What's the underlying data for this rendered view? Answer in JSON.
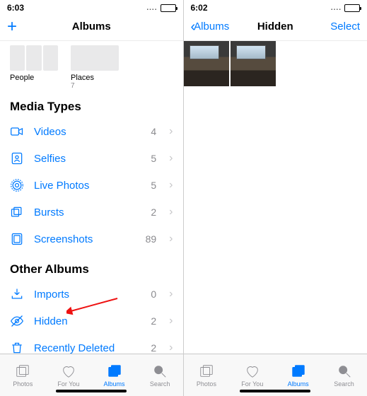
{
  "left": {
    "time": "6:03",
    "nav": {
      "title": "Albums"
    },
    "cards": [
      {
        "label": "People",
        "count": ""
      },
      {
        "label": "Places",
        "count": "7"
      }
    ],
    "sections": {
      "media_types": {
        "title": "Media Types",
        "rows": [
          {
            "icon": "video-icon",
            "label": "Videos",
            "count": "4"
          },
          {
            "icon": "selfie-icon",
            "label": "Selfies",
            "count": "5"
          },
          {
            "icon": "live-icon",
            "label": "Live Photos",
            "count": "5"
          },
          {
            "icon": "bursts-icon",
            "label": "Bursts",
            "count": "2"
          },
          {
            "icon": "screenshot-icon",
            "label": "Screenshots",
            "count": "89"
          }
        ]
      },
      "other": {
        "title": "Other Albums",
        "rows": [
          {
            "icon": "import-icon",
            "label": "Imports",
            "count": "0"
          },
          {
            "icon": "eye-icon",
            "label": "Hidden",
            "count": "2"
          },
          {
            "icon": "trash-icon",
            "label": "Recently Deleted",
            "count": "2"
          }
        ]
      }
    }
  },
  "right": {
    "time": "6:02",
    "nav": {
      "back": "Albums",
      "title": "Hidden",
      "action": "Select"
    }
  },
  "tabs": [
    {
      "id": "photos",
      "label": "Photos"
    },
    {
      "id": "foryou",
      "label": "For You"
    },
    {
      "id": "albums",
      "label": "Albums"
    },
    {
      "id": "search",
      "label": "Search"
    }
  ],
  "active_tab": "albums",
  "colors": {
    "tint": "#007aff"
  }
}
